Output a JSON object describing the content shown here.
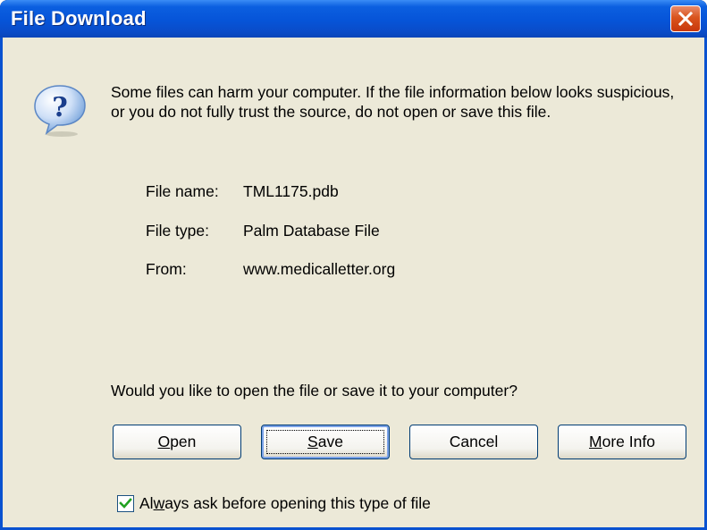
{
  "window": {
    "title": "File Download",
    "close_icon": "close-icon"
  },
  "message": {
    "icon": "question-icon",
    "text": "Some files can harm your computer. If the file information below looks suspicious, or you do not fully trust the source, do not open or save this file."
  },
  "file_info": [
    {
      "label": "File name:",
      "value": "TML1175.pdb"
    },
    {
      "label": "File type:",
      "value": "Palm Database File"
    },
    {
      "label": "From:",
      "value": "www.medicalletter.org"
    }
  ],
  "prompt": "Would you like to open the file or save it to your computer?",
  "buttons": {
    "open": {
      "accel": "O",
      "rest": "pen"
    },
    "save": {
      "accel": "S",
      "rest": "ave"
    },
    "cancel": {
      "label": "Cancel"
    },
    "more_info": {
      "accel": "M",
      "rest": "ore Info"
    }
  },
  "checkbox": {
    "checked": true,
    "label_pre": "Al",
    "label_accel": "w",
    "label_post": "ays ask before opening this type of file"
  },
  "colors": {
    "titlebar": "#0654d8",
    "client_bg": "#ece9d8",
    "close_button": "#d9541d",
    "check_mark": "#21a121"
  }
}
